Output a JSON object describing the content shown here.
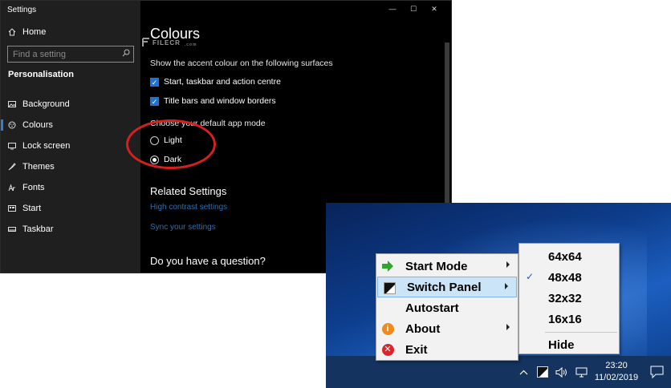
{
  "settings": {
    "window_title": "Settings",
    "home_label": "Home",
    "search_placeholder": "Find a setting",
    "section": "Personalisation",
    "nav_items": [
      {
        "label": "Background",
        "icon": "image-icon"
      },
      {
        "label": "Colours",
        "icon": "palette-icon"
      },
      {
        "label": "Lock screen",
        "icon": "lock-screen-icon"
      },
      {
        "label": "Themes",
        "icon": "themes-icon"
      },
      {
        "label": "Fonts",
        "icon": "fonts-icon"
      },
      {
        "label": "Start",
        "icon": "start-icon"
      },
      {
        "label": "Taskbar",
        "icon": "taskbar-icon"
      }
    ],
    "active_nav": "Colours",
    "caption_buttons": {
      "minimize": "—",
      "maximize": "☐",
      "close": "✕"
    },
    "page_title": "Colours",
    "watermark": "FILECR",
    "watermark_sub": ".com",
    "accent_label": "Show the accent colour on the following surfaces",
    "checkboxes": [
      {
        "label": "Start, taskbar and action centre",
        "checked": true
      },
      {
        "label": "Title bars and window borders",
        "checked": true
      }
    ],
    "mode_label": "Choose your default app mode",
    "modes": [
      {
        "label": "Light",
        "selected": false
      },
      {
        "label": "Dark",
        "selected": true
      }
    ],
    "related_heading": "Related Settings",
    "links": [
      "High contrast settings",
      "Sync your settings"
    ],
    "question_heading": "Do you have a question?",
    "colors": {
      "accent": "#1a73d9",
      "link": "#2c6fb5",
      "annotation": "#d81f1f"
    }
  },
  "context_menu": {
    "items": [
      {
        "label": "Start Mode",
        "icon": "green-arrow-icon",
        "submenu": true,
        "highlighted": false
      },
      {
        "label": "Switch Panel",
        "icon": "panel-icon",
        "submenu": true,
        "highlighted": true
      },
      {
        "label": "Autostart",
        "icon": "",
        "submenu": false,
        "highlighted": false
      },
      {
        "label": "About",
        "icon": "info-icon",
        "submenu": true,
        "highlighted": false
      },
      {
        "label": "Exit",
        "icon": "exit-icon",
        "submenu": false,
        "highlighted": false
      }
    ],
    "highlight_color": "#cce4f7"
  },
  "submenu": {
    "items": [
      {
        "label": "64x64",
        "checked": false
      },
      {
        "label": "48x48",
        "checked": true
      },
      {
        "label": "32x32",
        "checked": false
      },
      {
        "label": "16x16",
        "checked": false
      }
    ],
    "hide_label": "Hide"
  },
  "taskbar": {
    "time": "23:20",
    "date": "11/02/2019",
    "tray_icons": [
      "chevron-up-icon",
      "panel-tray-icon",
      "volume-icon",
      "network-icon"
    ],
    "notification_icon": "action-center-icon"
  }
}
